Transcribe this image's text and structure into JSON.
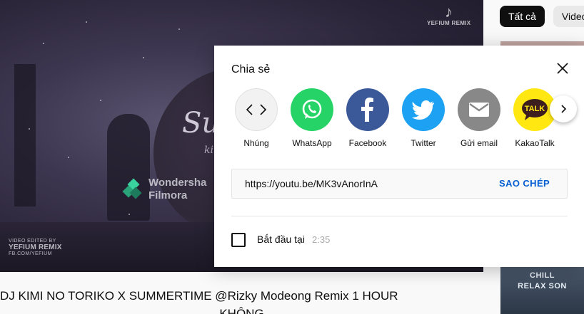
{
  "player": {
    "song_title": "Su",
    "song_sub": "ki",
    "watermark_line1": "Wondersha",
    "watermark_line2": "Filmora",
    "tiktok_brand": "YEFIUM REMIX",
    "credit_line1": "VIDEO EDITED BY",
    "credit_brand": "YEFIUM REMIX",
    "credit_line3": "FB.COM/YEFIUM"
  },
  "video": {
    "title_line1": "DJ KIMI NO TORIKO X SUMMERTIME @Rizky Modeong Remix 1 HOUR",
    "title_line2": "KHÔNG"
  },
  "chips": [
    {
      "label": "Tất cả"
    },
    {
      "label": "Video"
    }
  ],
  "thumb_bottom": {
    "line1": "CHILL",
    "line2": "RELAX SON"
  },
  "dialog": {
    "title": "Chia sẻ",
    "share_targets": [
      {
        "label": "Nhúng",
        "icon": "embed-code-icon",
        "color": "#f2f2f2"
      },
      {
        "label": "WhatsApp",
        "icon": "whatsapp-icon",
        "color": "#25d366"
      },
      {
        "label": "Facebook",
        "icon": "facebook-icon",
        "color": "#3b5998"
      },
      {
        "label": "Twitter",
        "icon": "twitter-icon",
        "color": "#1da1f2"
      },
      {
        "label": "Gửi email",
        "icon": "email-icon",
        "color": "#888888"
      },
      {
        "label": "KakaoTalk",
        "icon": "kakaotalk-icon",
        "color": "#ffe812"
      }
    ],
    "url": "https://youtu.be/MK3vAnorInA",
    "copy_label": "SAO CHÉP",
    "start_label": "Bắt đầu tại",
    "start_time": "2:35",
    "kakao_text": "TALK"
  }
}
